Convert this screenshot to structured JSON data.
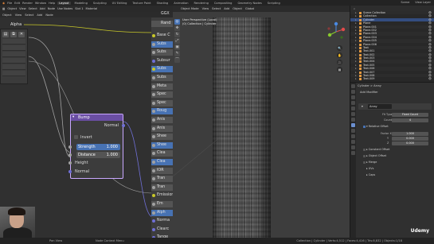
{
  "topbar": {
    "menus": [
      "File",
      "Edit",
      "Render",
      "Window",
      "Help"
    ],
    "workspaces": [
      "Layout",
      "Modeling",
      "Sculpting",
      "UV Editing",
      "Texture Paint",
      "Shading",
      "Animation",
      "Rendering",
      "Compositing",
      "Geometry Nodes",
      "Scripting"
    ],
    "active_workspace": "Layout",
    "scene": "Scene",
    "view_layer": "View Layer"
  },
  "node_editor": {
    "header": [
      "Object",
      "View",
      "Select",
      "Add",
      "Node",
      "Use Nodes",
      "Slot 1",
      "Material"
    ],
    "header2": [
      "Object",
      "View",
      "Select",
      "Add",
      "Node"
    ],
    "material_label": "Alpha",
    "bump_node": {
      "title": "Bump",
      "output": "Normal",
      "invert": "Invert",
      "strength_label": "Strength",
      "strength_value": "1.000",
      "distance_label": "Distance",
      "distance_value": "1.000",
      "height": "Height",
      "normal": "Normal"
    },
    "principled_top": "GGX",
    "principled_top2": "Rand",
    "principled_rows": [
      {
        "label": "Base C",
        "style": "plain",
        "sock": "yellow"
      },
      {
        "label": "Subs",
        "style": "blue",
        "sock": "grey"
      },
      {
        "label": "Subs",
        "style": "field",
        "sock": "grey"
      },
      {
        "label": "Subsur",
        "style": "plain",
        "sock": "purple"
      },
      {
        "label": "Subs",
        "style": "blue",
        "sock": "yellow"
      },
      {
        "label": "Subs",
        "style": "field",
        "sock": "grey"
      },
      {
        "label": "Meta",
        "style": "field",
        "sock": "grey"
      },
      {
        "label": "Spec",
        "style": "field",
        "sock": "grey"
      },
      {
        "label": "Spec",
        "style": "field",
        "sock": "grey"
      },
      {
        "label": "Roug",
        "style": "blue",
        "sock": "grey"
      },
      {
        "label": "Anis",
        "style": "field",
        "sock": "grey"
      },
      {
        "label": "Anis",
        "style": "field",
        "sock": "grey"
      },
      {
        "label": "Shee",
        "style": "field",
        "sock": "grey"
      },
      {
        "label": "Shee",
        "style": "blue",
        "sock": "grey"
      },
      {
        "label": "Clea",
        "style": "field",
        "sock": "grey"
      },
      {
        "label": "Clea",
        "style": "blue",
        "sock": "grey"
      },
      {
        "label": "IOR",
        "style": "field",
        "sock": "grey"
      },
      {
        "label": "Tran",
        "style": "field",
        "sock": "grey"
      },
      {
        "label": "Tran",
        "style": "field",
        "sock": "grey"
      },
      {
        "label": "Emission",
        "style": "plain",
        "sock": "yellow"
      },
      {
        "label": "Em",
        "style": "field",
        "sock": "grey"
      },
      {
        "label": "Alph",
        "style": "blue",
        "sock": "grey"
      },
      {
        "label": "Norma",
        "style": "plain",
        "sock": "purple"
      },
      {
        "label": "Clearc",
        "style": "plain",
        "sock": "purple"
      },
      {
        "label": "Tange",
        "style": "plain",
        "sock": "purple"
      }
    ]
  },
  "viewport": {
    "header": [
      "Object Mode",
      "View",
      "Select",
      "Add",
      "Object",
      "Global"
    ],
    "info_line1": "User Perspective (Local)",
    "info_line2": "(0) Collection | Cylinder",
    "tools": [
      "◎",
      "✥",
      "↻",
      "⤢",
      "▣",
      "✎",
      "⌒"
    ],
    "nav_buttons": [
      "🔍",
      "✋",
      "🎥",
      "▦"
    ]
  },
  "outliner": {
    "header": "Scene Collection",
    "rows": [
      {
        "label": "Scene Collection",
        "selected": false
      },
      {
        "label": "Collection",
        "selected": false
      },
      {
        "label": "Cylinder",
        "selected": true
      },
      {
        "label": "Plane",
        "selected": false
      },
      {
        "label": "Plane.001",
        "selected": false
      },
      {
        "label": "Plane.002",
        "selected": false
      },
      {
        "label": "Plane.003",
        "selected": false
      },
      {
        "label": "Plane.004",
        "selected": false
      },
      {
        "label": "Plane.005",
        "selected": false
      },
      {
        "label": "Plane.006",
        "selected": false
      },
      {
        "label": "Text",
        "selected": false
      },
      {
        "label": "Text.001",
        "selected": false
      },
      {
        "label": "Text.002",
        "selected": false
      },
      {
        "label": "Text.003",
        "selected": false
      },
      {
        "label": "Text.004",
        "selected": false
      },
      {
        "label": "Text.005",
        "selected": false
      },
      {
        "label": "Text.006",
        "selected": false
      },
      {
        "label": "Text.007",
        "selected": false
      },
      {
        "label": "Text.008",
        "selected": false
      },
      {
        "label": "Text.009",
        "selected": false
      }
    ]
  },
  "properties": {
    "breadcrumb": "Cylinder  >  Array",
    "add_modifier": "Add Modifier",
    "modifier_name": "Array",
    "fit_type_label": "Fit Type",
    "fit_type_value": "Fixed Count",
    "count_label": "Count",
    "count_value": "4",
    "relative_offset": "Relative Offset",
    "factor_x_label": "Factor X",
    "factor_x": "1.000",
    "factor_y_label": "Y",
    "factor_y": "0.000",
    "factor_z_label": "Z",
    "factor_z": "0.000",
    "sections": [
      "Constant Offset",
      "Object Offset",
      "Merge",
      "UVs",
      "Caps"
    ]
  },
  "status_bar": {
    "left": "Pan View",
    "middle": "Node Context Menu",
    "right": "Collection | Cylinder | Verts:4,512 | Faces:4,416 | Tris:8,832 | Objects:1/18"
  },
  "watermark": "Udemy"
}
